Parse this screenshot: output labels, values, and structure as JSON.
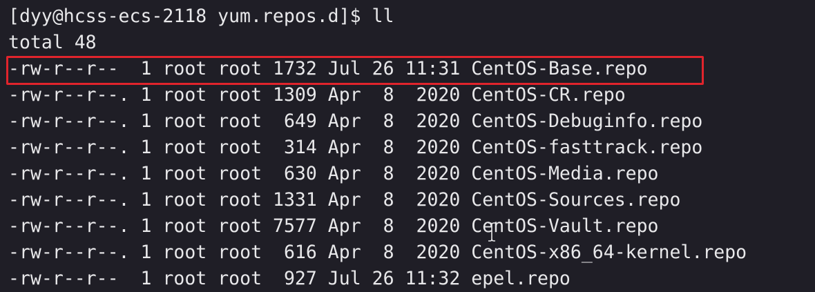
{
  "terminal": {
    "prompt_line": "[dyy@hcss-ecs-2118 yum.repos.d]$ ll",
    "total_line": "total 48",
    "files": [
      {
        "perms": "-rw-r--r-- ",
        "links": "1",
        "owner": "root",
        "group": "root",
        "size": "1732",
        "month": "Jul",
        "day": "26",
        "time": "11:31",
        "name": "CentOS-Base.repo"
      },
      {
        "perms": "-rw-r--r--.",
        "links": "1",
        "owner": "root",
        "group": "root",
        "size": "1309",
        "month": "Apr",
        "day": " 8",
        "time": " 2020",
        "name": "CentOS-CR.repo"
      },
      {
        "perms": "-rw-r--r--.",
        "links": "1",
        "owner": "root",
        "group": "root",
        "size": " 649",
        "month": "Apr",
        "day": " 8",
        "time": " 2020",
        "name": "CentOS-Debuginfo.repo"
      },
      {
        "perms": "-rw-r--r--.",
        "links": "1",
        "owner": "root",
        "group": "root",
        "size": " 314",
        "month": "Apr",
        "day": " 8",
        "time": " 2020",
        "name": "CentOS-fasttrack.repo"
      },
      {
        "perms": "-rw-r--r--.",
        "links": "1",
        "owner": "root",
        "group": "root",
        "size": " 630",
        "month": "Apr",
        "day": " 8",
        "time": " 2020",
        "name": "CentOS-Media.repo"
      },
      {
        "perms": "-rw-r--r--.",
        "links": "1",
        "owner": "root",
        "group": "root",
        "size": "1331",
        "month": "Apr",
        "day": " 8",
        "time": " 2020",
        "name": "CentOS-Sources.repo"
      },
      {
        "perms": "-rw-r--r--.",
        "links": "1",
        "owner": "root",
        "group": "root",
        "size": "7577",
        "month": "Apr",
        "day": " 8",
        "time": " 2020",
        "name": "CentOS-Vault.repo"
      },
      {
        "perms": "-rw-r--r--.",
        "links": "1",
        "owner": "root",
        "group": "root",
        "size": " 616",
        "month": "Apr",
        "day": " 8",
        "time": " 2020",
        "name": "CentOS-x86_64-kernel.repo"
      },
      {
        "perms": "-rw-r--r-- ",
        "links": "1",
        "owner": "root",
        "group": "root",
        "size": " 927",
        "month": "Jul",
        "day": "26",
        "time": "11:32",
        "name": "epel.repo"
      }
    ]
  },
  "colors": {
    "background": "#1f1e26",
    "text": "#e8e8ea",
    "highlight": "#e0242c"
  },
  "icons": {
    "cursor": "i-beam-cursor-icon"
  }
}
